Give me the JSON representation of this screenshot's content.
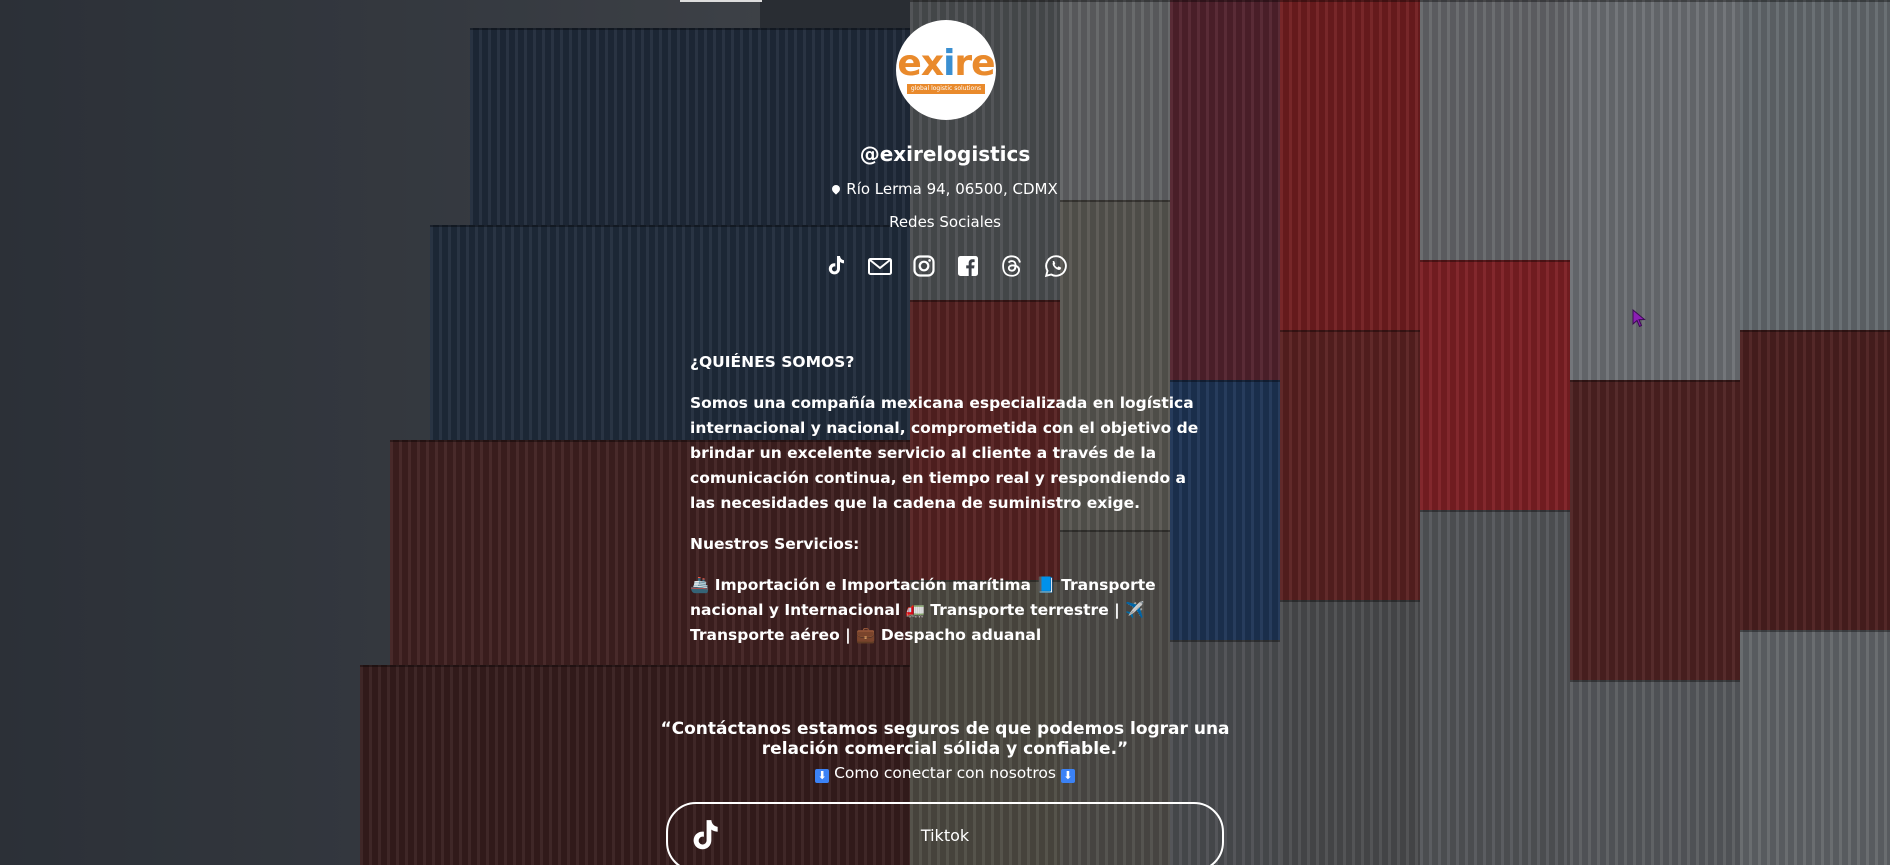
{
  "profile": {
    "logo_text_orange": "ex",
    "logo_text_blue": "i",
    "logo_text_orange2": "re",
    "logo_tagline": "global logistic solutions",
    "handle": "@exirelogistics",
    "address": "Río Lerma 94, 06500, CDMX",
    "social_label": "Redes Sociales"
  },
  "social_icons": [
    "tiktok-icon",
    "mail-icon",
    "instagram-icon",
    "facebook-icon",
    "threads-icon",
    "whatsapp-icon"
  ],
  "about": {
    "heading": "¿QUIÉNES SOMOS?",
    "body": "Somos una compañía mexicana especializada en logística internacional y nacional, comprometida con el objetivo de brindar un excelente servicio al cliente a través de la comunicación continua, en tiempo real y respondiendo a las necesidades que la cadena de suministro exige.",
    "services_heading": "Nuestros Servicios:",
    "services": "🚢 Importación e Importación marítima 📘 Transporte nacional y Internacional 🚛 Transporte terrestre | ✈️ Transporte aéreo | 💼 Despacho aduanal"
  },
  "cta": {
    "quote": "“Contáctanos estamos seguros de que podemos lograr una relación comercial sólida y confiable.”",
    "connect_prefix": "⬇",
    "connect_text": "Como conectar con nosotros",
    "connect_suffix": "⬇"
  },
  "links": {
    "tiktok_label": "Tiktok"
  },
  "colors": {
    "brand_orange": "#e98a2c",
    "brand_blue": "#3a8fd1",
    "text": "#ffffff"
  }
}
